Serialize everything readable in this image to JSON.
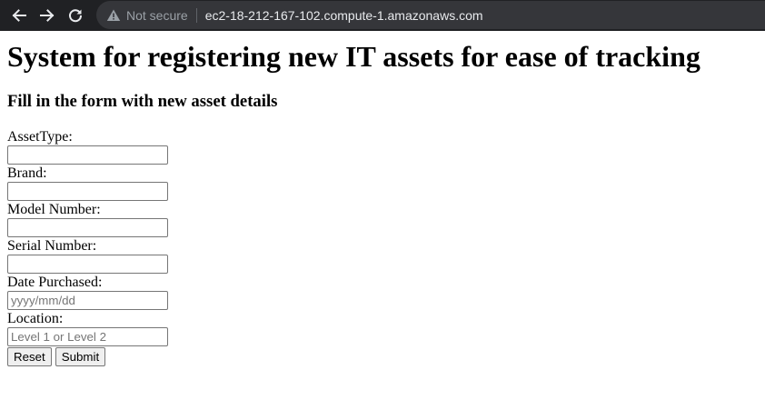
{
  "browser": {
    "security_label": "Not secure",
    "url": "ec2-18-212-167-102.compute-1.amazonaws.com",
    "icons": {
      "back": "back-arrow-icon",
      "forward": "forward-arrow-icon",
      "reload": "reload-icon",
      "security": "warning-triangle-icon"
    },
    "colors": {
      "toolbar_bg": "#202124",
      "omnibox_bg": "#35363a",
      "url_text": "#e8eaed",
      "muted_text": "#9aa0a6"
    }
  },
  "page": {
    "title": "System for registering new IT assets for ease of tracking",
    "subtitle": "Fill in the form with new asset details"
  },
  "form": {
    "asset_type": {
      "label": "AssetType:",
      "value": "",
      "placeholder": ""
    },
    "brand": {
      "label": "Brand:",
      "value": "",
      "placeholder": ""
    },
    "model_number": {
      "label": "Model Number:",
      "value": "",
      "placeholder": ""
    },
    "serial_number": {
      "label": "Serial Number:",
      "value": "",
      "placeholder": ""
    },
    "date_purchased": {
      "label": "Date Purchased:",
      "value": "",
      "placeholder": "yyyy/mm/dd"
    },
    "location": {
      "label": "Location:",
      "value": "",
      "placeholder": "Level 1 or Level 2"
    },
    "reset_label": "Reset",
    "submit_label": "Submit"
  }
}
